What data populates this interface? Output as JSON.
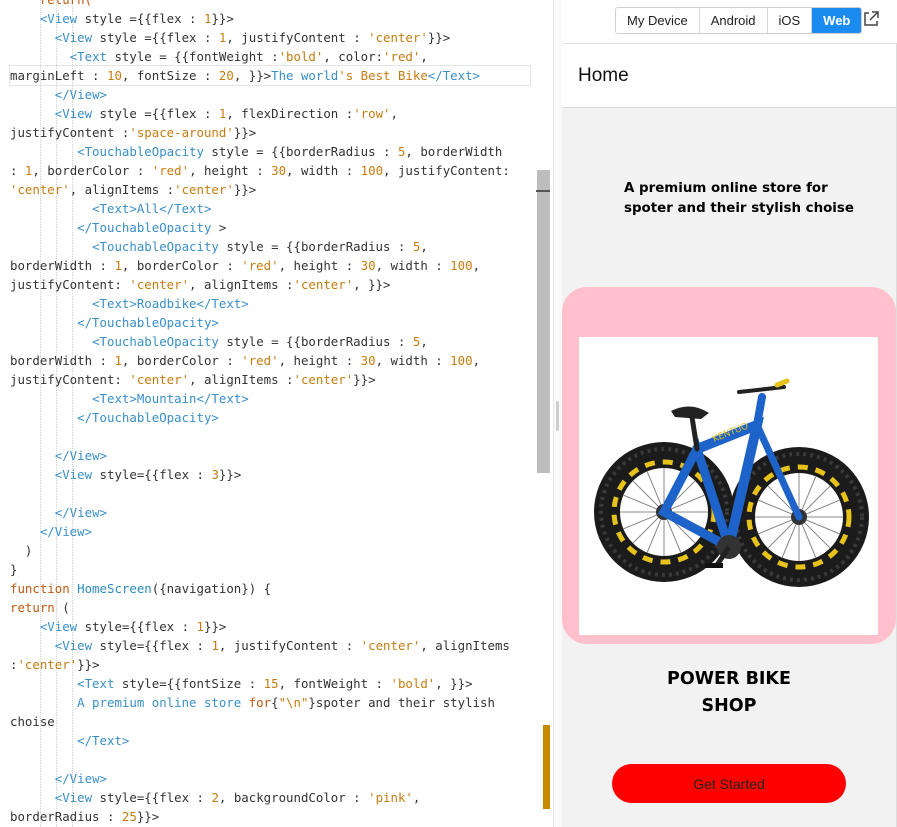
{
  "editor": {
    "lines": [
      [
        {
          "t": "    return(",
          "c": "kw"
        }
      ],
      [
        {
          "t": "    ",
          "c": ""
        },
        {
          "t": "<View",
          "c": "tag"
        },
        {
          "t": " style ={{flex : ",
          "c": ""
        },
        {
          "t": "1",
          "c": "num"
        },
        {
          "t": "}}>",
          "c": ""
        }
      ],
      [
        {
          "t": "      ",
          "c": ""
        },
        {
          "t": "<View",
          "c": "tag"
        },
        {
          "t": " style ={{flex : ",
          "c": ""
        },
        {
          "t": "1",
          "c": "num"
        },
        {
          "t": ", justifyContent : ",
          "c": ""
        },
        {
          "t": "'center'",
          "c": "str"
        },
        {
          "t": "}}>",
          "c": ""
        }
      ],
      [
        {
          "t": "        ",
          "c": ""
        },
        {
          "t": "<Text",
          "c": "tag"
        },
        {
          "t": " style = {{fontWeight :",
          "c": ""
        },
        {
          "t": "'bold'",
          "c": "str"
        },
        {
          "t": ", color:",
          "c": ""
        },
        {
          "t": "'red'",
          "c": "str"
        },
        {
          "t": ",",
          "c": ""
        }
      ],
      [
        {
          "t": "marginLeft : ",
          "c": ""
        },
        {
          "t": "10",
          "c": "num"
        },
        {
          "t": ", fontSize : ",
          "c": ""
        },
        {
          "t": "20",
          "c": "num"
        },
        {
          "t": ", }}>",
          "c": ""
        },
        {
          "t": "The world",
          "c": "tag"
        },
        {
          "t": "'s Best Bike",
          "c": "str"
        },
        {
          "t": "</Text>",
          "c": "tag"
        }
      ],
      [
        {
          "t": "      ",
          "c": ""
        },
        {
          "t": "</View>",
          "c": "tag"
        }
      ],
      [
        {
          "t": "      ",
          "c": ""
        },
        {
          "t": "<View",
          "c": "tag"
        },
        {
          "t": " style ={{flex : ",
          "c": ""
        },
        {
          "t": "1",
          "c": "num"
        },
        {
          "t": ", flexDirection :",
          "c": ""
        },
        {
          "t": "'row'",
          "c": "str"
        },
        {
          "t": ",",
          "c": ""
        }
      ],
      [
        {
          "t": "justifyContent :",
          "c": ""
        },
        {
          "t": "'space-around'",
          "c": "str"
        },
        {
          "t": "}}>",
          "c": ""
        }
      ],
      [
        {
          "t": "         ",
          "c": ""
        },
        {
          "t": "<TouchableOpacity",
          "c": "tag"
        },
        {
          "t": " style = {{borderRadius : ",
          "c": ""
        },
        {
          "t": "5",
          "c": "num"
        },
        {
          "t": ", borderWidth",
          "c": ""
        }
      ],
      [
        {
          "t": ": ",
          "c": ""
        },
        {
          "t": "1",
          "c": "num"
        },
        {
          "t": ", borderColor : ",
          "c": ""
        },
        {
          "t": "'red'",
          "c": "str"
        },
        {
          "t": ", height : ",
          "c": ""
        },
        {
          "t": "30",
          "c": "num"
        },
        {
          "t": ", width : ",
          "c": ""
        },
        {
          "t": "100",
          "c": "num"
        },
        {
          "t": ", justifyContent:",
          "c": ""
        }
      ],
      [
        {
          "t": "'center'",
          "c": "str"
        },
        {
          "t": ", alignItems :",
          "c": ""
        },
        {
          "t": "'center'",
          "c": "str"
        },
        {
          "t": "}}>",
          "c": ""
        }
      ],
      [
        {
          "t": "           ",
          "c": ""
        },
        {
          "t": "<Text>",
          "c": "tag"
        },
        {
          "t": "All",
          "c": "tag"
        },
        {
          "t": "</Text>",
          "c": "tag"
        }
      ],
      [
        {
          "t": "         ",
          "c": ""
        },
        {
          "t": "</TouchableOpacity",
          "c": "tag"
        },
        {
          "t": " >",
          "c": ""
        }
      ],
      [
        {
          "t": "           ",
          "c": ""
        },
        {
          "t": "<TouchableOpacity",
          "c": "tag"
        },
        {
          "t": " style = {{borderRadius : ",
          "c": ""
        },
        {
          "t": "5",
          "c": "num"
        },
        {
          "t": ",",
          "c": ""
        }
      ],
      [
        {
          "t": "borderWidth : ",
          "c": ""
        },
        {
          "t": "1",
          "c": "num"
        },
        {
          "t": ", borderColor : ",
          "c": ""
        },
        {
          "t": "'red'",
          "c": "str"
        },
        {
          "t": ", height : ",
          "c": ""
        },
        {
          "t": "30",
          "c": "num"
        },
        {
          "t": ", width : ",
          "c": ""
        },
        {
          "t": "100",
          "c": "num"
        },
        {
          "t": ",",
          "c": ""
        }
      ],
      [
        {
          "t": "justifyContent: ",
          "c": ""
        },
        {
          "t": "'center'",
          "c": "str"
        },
        {
          "t": ", alignItems :",
          "c": ""
        },
        {
          "t": "'center'",
          "c": "str"
        },
        {
          "t": ", }}>",
          "c": ""
        }
      ],
      [
        {
          "t": "           ",
          "c": ""
        },
        {
          "t": "<Text>",
          "c": "tag"
        },
        {
          "t": "Roadbike",
          "c": "tag"
        },
        {
          "t": "</Text>",
          "c": "tag"
        }
      ],
      [
        {
          "t": "         ",
          "c": ""
        },
        {
          "t": "</TouchableOpacity>",
          "c": "tag"
        }
      ],
      [
        {
          "t": "           ",
          "c": ""
        },
        {
          "t": "<TouchableOpacity",
          "c": "tag"
        },
        {
          "t": " style = {{borderRadius : ",
          "c": ""
        },
        {
          "t": "5",
          "c": "num"
        },
        {
          "t": ",",
          "c": ""
        }
      ],
      [
        {
          "t": "borderWidth : ",
          "c": ""
        },
        {
          "t": "1",
          "c": "num"
        },
        {
          "t": ", borderColor : ",
          "c": ""
        },
        {
          "t": "'red'",
          "c": "str"
        },
        {
          "t": ", height : ",
          "c": ""
        },
        {
          "t": "30",
          "c": "num"
        },
        {
          "t": ", width : ",
          "c": ""
        },
        {
          "t": "100",
          "c": "num"
        },
        {
          "t": ",",
          "c": ""
        }
      ],
      [
        {
          "t": "justifyContent: ",
          "c": ""
        },
        {
          "t": "'center'",
          "c": "str"
        },
        {
          "t": ", alignItems :",
          "c": ""
        },
        {
          "t": "'center'",
          "c": "str"
        },
        {
          "t": "}}>",
          "c": ""
        }
      ],
      [
        {
          "t": "           ",
          "c": ""
        },
        {
          "t": "<Text>",
          "c": "tag"
        },
        {
          "t": "Mountain",
          "c": "tag"
        },
        {
          "t": "</Text>",
          "c": "tag"
        }
      ],
      [
        {
          "t": "         ",
          "c": ""
        },
        {
          "t": "</TouchableOpacity>",
          "c": "tag"
        }
      ],
      [
        {
          "t": "",
          "c": ""
        }
      ],
      [
        {
          "t": "      ",
          "c": ""
        },
        {
          "t": "</View>",
          "c": "tag"
        }
      ],
      [
        {
          "t": "      ",
          "c": ""
        },
        {
          "t": "<View",
          "c": "tag"
        },
        {
          "t": " style={{flex : ",
          "c": ""
        },
        {
          "t": "3",
          "c": "num"
        },
        {
          "t": "}}>",
          "c": ""
        }
      ],
      [
        {
          "t": "",
          "c": ""
        }
      ],
      [
        {
          "t": "      ",
          "c": ""
        },
        {
          "t": "</View>",
          "c": "tag"
        }
      ],
      [
        {
          "t": "    ",
          "c": ""
        },
        {
          "t": "</View>",
          "c": "tag"
        }
      ],
      [
        {
          "t": "  )",
          "c": ""
        }
      ],
      [
        {
          "t": "}",
          "c": ""
        }
      ],
      [
        {
          "t": "function ",
          "c": "kw"
        },
        {
          "t": "HomeScreen",
          "c": "fn"
        },
        {
          "t": "({navigation}) {",
          "c": ""
        }
      ],
      [
        {
          "t": "return",
          "c": "kw"
        },
        {
          "t": " (",
          "c": ""
        }
      ],
      [
        {
          "t": "    ",
          "c": ""
        },
        {
          "t": "<View",
          "c": "tag"
        },
        {
          "t": " style={{flex : ",
          "c": ""
        },
        {
          "t": "1",
          "c": "num"
        },
        {
          "t": "}}>",
          "c": ""
        }
      ],
      [
        {
          "t": "      ",
          "c": ""
        },
        {
          "t": "<View",
          "c": "tag"
        },
        {
          "t": " style={{flex : ",
          "c": ""
        },
        {
          "t": "1",
          "c": "num"
        },
        {
          "t": ", justifyContent : ",
          "c": ""
        },
        {
          "t": "'center'",
          "c": "str"
        },
        {
          "t": ", alignItems",
          "c": ""
        }
      ],
      [
        {
          "t": ":",
          "c": ""
        },
        {
          "t": "'center'",
          "c": "str"
        },
        {
          "t": "}}>",
          "c": ""
        }
      ],
      [
        {
          "t": "         ",
          "c": ""
        },
        {
          "t": "<Text",
          "c": "tag"
        },
        {
          "t": " style={{fontSize : ",
          "c": ""
        },
        {
          "t": "15",
          "c": "num"
        },
        {
          "t": ", fontWeight : ",
          "c": ""
        },
        {
          "t": "'bold'",
          "c": "str"
        },
        {
          "t": ", }}>",
          "c": ""
        }
      ],
      [
        {
          "t": "         ",
          "c": ""
        },
        {
          "t": "A premium online store ",
          "c": "tag"
        },
        {
          "t": "for",
          "c": "kw"
        },
        {
          "t": "{",
          "c": ""
        },
        {
          "t": "\"\\n\"",
          "c": "str"
        },
        {
          "t": "}spoter and their stylish",
          "c": ""
        }
      ],
      [
        {
          "t": "choise",
          "c": ""
        }
      ],
      [
        {
          "t": "         ",
          "c": ""
        },
        {
          "t": "</Text>",
          "c": "tag"
        }
      ],
      [
        {
          "t": "",
          "c": ""
        }
      ],
      [
        {
          "t": "      ",
          "c": ""
        },
        {
          "t": "</View>",
          "c": "tag"
        }
      ],
      [
        {
          "t": "      ",
          "c": ""
        },
        {
          "t": "<View",
          "c": "tag"
        },
        {
          "t": " style={{flex : ",
          "c": ""
        },
        {
          "t": "2",
          "c": "num"
        },
        {
          "t": ", backgroundColor : ",
          "c": ""
        },
        {
          "t": "'pink'",
          "c": "str"
        },
        {
          "t": ",",
          "c": ""
        }
      ],
      [
        {
          "t": "borderRadius : ",
          "c": ""
        },
        {
          "t": "25",
          "c": "num"
        },
        {
          "t": "}}>",
          "c": ""
        }
      ]
    ],
    "current_line_index": 4
  },
  "preview": {
    "tabs": [
      {
        "label": "My Device",
        "active": false
      },
      {
        "label": "Android",
        "active": false
      },
      {
        "label": "iOS",
        "active": false
      },
      {
        "label": "Web",
        "active": true
      }
    ],
    "open_external_icon": "external-link-icon",
    "nav_title": "Home",
    "tagline": "A premium online store for\nspoter and their stylish choise",
    "image_icon": "bike-photo",
    "shop_title": "POWER BIKE\nSHOP",
    "button_label": "Get Started",
    "colors": {
      "accent": "#1a8cf0",
      "pink": "#ffc0cb",
      "button": "#ff0000",
      "code_tag": "#3a8fc9",
      "code_string": "#c77c10",
      "code_keyword": "#c05a10"
    }
  }
}
